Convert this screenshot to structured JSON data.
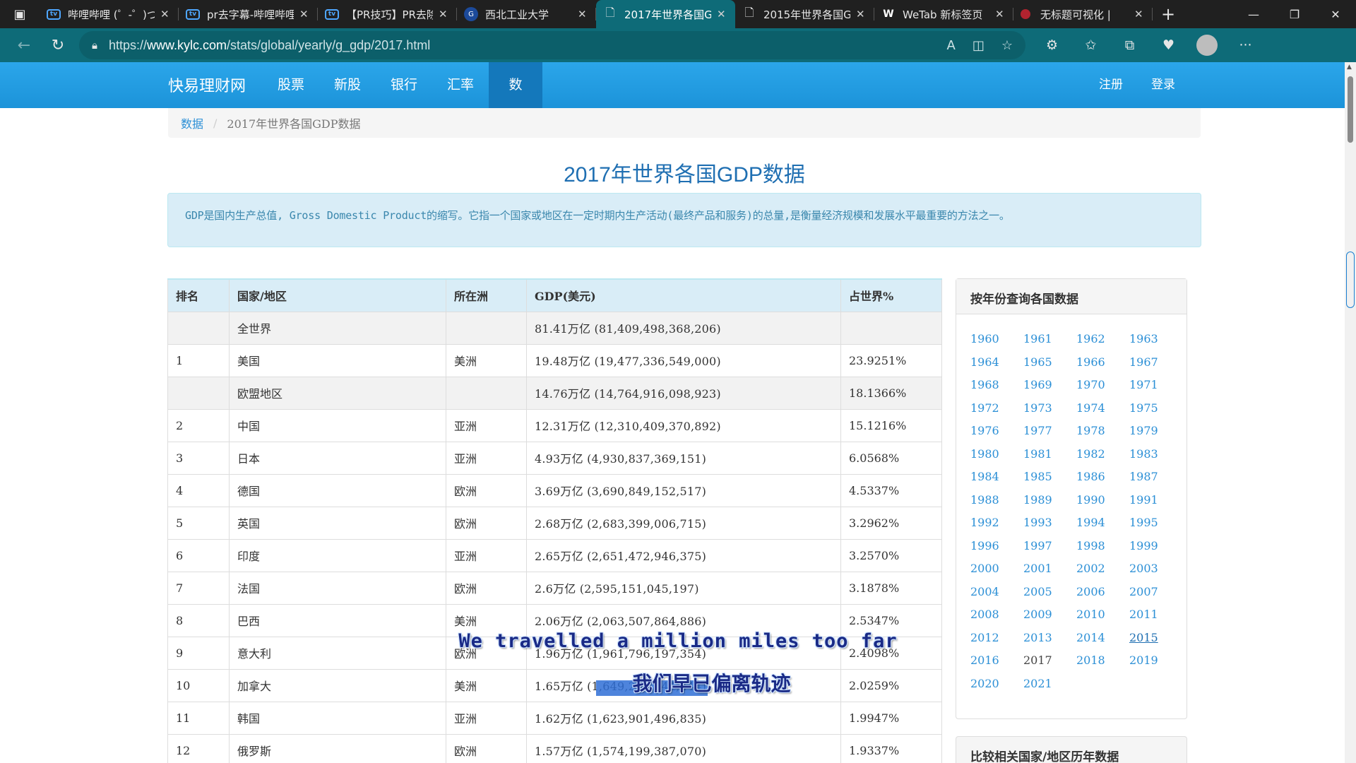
{
  "browser": {
    "tabs": [
      {
        "title": "哔哩哔哩 (゜-゜)つ",
        "icon": "bilibili-icon",
        "active": false
      },
      {
        "title": "pr去字幕-哔哩哔哩",
        "icon": "bilibili-icon",
        "active": false
      },
      {
        "title": "【PR技巧】PR去除",
        "icon": "bilibili-icon",
        "active": false
      },
      {
        "title": "西北工业大学",
        "icon": "nwpu-icon",
        "active": false
      },
      {
        "title": "2017年世界各国G",
        "icon": "document-icon",
        "active": true
      },
      {
        "title": "2015年世界各国G",
        "icon": "document-icon",
        "active": false
      },
      {
        "title": "WeTab 新标签页",
        "icon": "wetab-icon",
        "active": false
      },
      {
        "title": "无标题可视化 |",
        "icon": "red-dot-icon",
        "active": false
      }
    ],
    "url_prefix": "https://",
    "url_host": "www.kylc.com",
    "url_path": "/stats/global/yearly/g_gdp/2017.html"
  },
  "site": {
    "brand": "快易理财网",
    "nav": [
      "股票",
      "新股",
      "银行",
      "汇率",
      "数据"
    ],
    "nav_active_index": 4,
    "register": "注册",
    "login": "登录"
  },
  "breadcrumb": {
    "root": "数据",
    "separator": "/",
    "current": "2017年世界各国GDP数据"
  },
  "page_title": "2017年世界各国GDP数据",
  "intro": "GDP是国内生产总值, Gross Domestic Product的缩写。它指一个国家或地区在一定时期内生产活动(最终产品和服务)的总量,是衡量经济规模和发展水平最重要的方法之一。",
  "table": {
    "headers": [
      "排名",
      "国家/地区",
      "所在洲",
      "GDP(美元)",
      "占世界%"
    ],
    "rows": [
      {
        "rank": "",
        "name": "全世界",
        "continent": "",
        "gdp": "81.41万亿 (81,409,498,368,206)",
        "share": "",
        "aggregate": true
      },
      {
        "rank": "1",
        "name": "美国",
        "continent": "美洲",
        "gdp": "19.48万亿 (19,477,336,549,000)",
        "share": "23.9251%",
        "aggregate": false
      },
      {
        "rank": "",
        "name": "欧盟地区",
        "continent": "",
        "gdp": "14.76万亿 (14,764,916,098,923)",
        "share": "18.1366%",
        "aggregate": true
      },
      {
        "rank": "2",
        "name": "中国",
        "continent": "亚洲",
        "gdp": "12.31万亿 (12,310,409,370,892)",
        "share": "15.1216%",
        "aggregate": false
      },
      {
        "rank": "3",
        "name": "日本",
        "continent": "亚洲",
        "gdp": "4.93万亿 (4,930,837,369,151)",
        "share": "6.0568%",
        "aggregate": false
      },
      {
        "rank": "4",
        "name": "德国",
        "continent": "欧洲",
        "gdp": "3.69万亿 (3,690,849,152,517)",
        "share": "4.5337%",
        "aggregate": false
      },
      {
        "rank": "5",
        "name": "英国",
        "continent": "欧洲",
        "gdp": "2.68万亿 (2,683,399,006,715)",
        "share": "3.2962%",
        "aggregate": false
      },
      {
        "rank": "6",
        "name": "印度",
        "continent": "亚洲",
        "gdp": "2.65万亿 (2,651,472,946,375)",
        "share": "3.2570%",
        "aggregate": false
      },
      {
        "rank": "7",
        "name": "法国",
        "continent": "欧洲",
        "gdp": "2.6万亿 (2,595,151,045,197)",
        "share": "3.1878%",
        "aggregate": false
      },
      {
        "rank": "8",
        "name": "巴西",
        "continent": "美洲",
        "gdp": "2.06万亿 (2,063,507,864,886)",
        "share": "2.5347%",
        "aggregate": false
      },
      {
        "rank": "9",
        "name": "意大利",
        "continent": "欧洲",
        "gdp": "1.96万亿 (1,961,796,197,354)",
        "share": "2.4098%",
        "aggregate": false
      },
      {
        "rank": "10",
        "name": "加拿大",
        "continent": "美洲",
        "gdp": "1.65万亿 (1,649,265,644,244)",
        "share": "2.0259%",
        "aggregate": false
      },
      {
        "rank": "11",
        "name": "韩国",
        "continent": "亚洲",
        "gdp": "1.62万亿 (1,623,901,496,835)",
        "share": "1.9947%",
        "aggregate": false
      },
      {
        "rank": "12",
        "name": "俄罗斯",
        "continent": "欧洲",
        "gdp": "1.57万亿 (1,574,199,387,070)",
        "share": "1.9337%",
        "aggregate": false
      }
    ]
  },
  "year_panel": {
    "title": "按年份查询各国数据",
    "years": [
      "1960",
      "1961",
      "1962",
      "1963",
      "1964",
      "1965",
      "1966",
      "1967",
      "1968",
      "1969",
      "1970",
      "1971",
      "1972",
      "1973",
      "1974",
      "1975",
      "1976",
      "1977",
      "1978",
      "1979",
      "1980",
      "1981",
      "1982",
      "1983",
      "1984",
      "1985",
      "1986",
      "1987",
      "1988",
      "1989",
      "1990",
      "1991",
      "1992",
      "1993",
      "1994",
      "1995",
      "1996",
      "1997",
      "1998",
      "1999",
      "2000",
      "2001",
      "2002",
      "2003",
      "2004",
      "2005",
      "2006",
      "2007",
      "2008",
      "2009",
      "2010",
      "2011",
      "2012",
      "2013",
      "2014",
      "2015",
      "2016",
      "2017",
      "2018",
      "2019",
      "2020",
      "2021"
    ],
    "current": "2017",
    "hovered": "2015"
  },
  "compare_panel": {
    "title": "比较相关国家/地区历年数据"
  },
  "subtitles": {
    "english": "We travelled a million miles too far",
    "chinese": "我们早已偏离轨迹"
  }
}
